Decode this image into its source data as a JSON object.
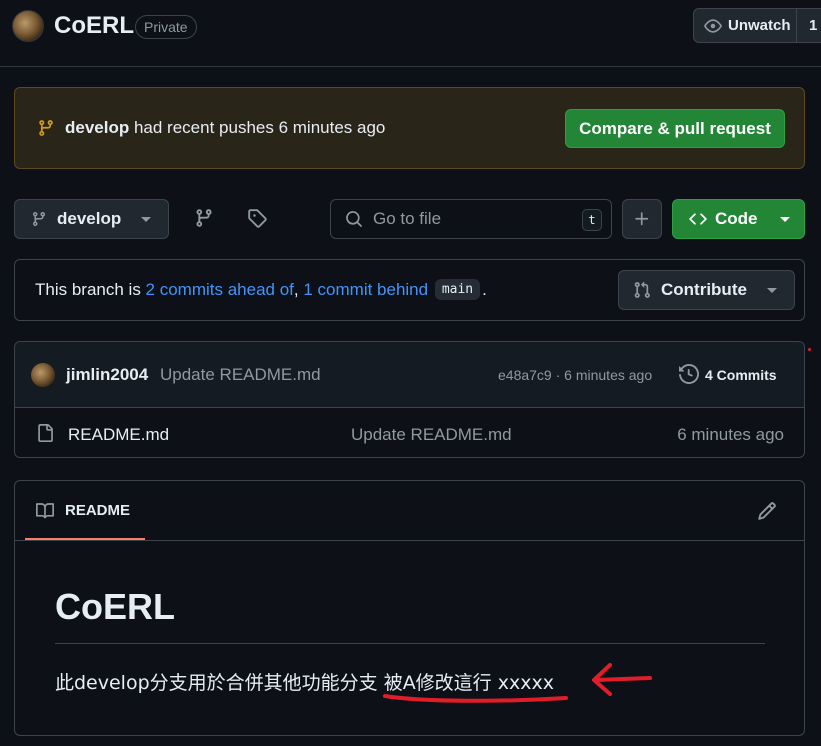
{
  "header": {
    "repo_name": "CoERL",
    "visibility": "Private",
    "watch_label": "Unwatch",
    "watch_count": "1"
  },
  "push_banner": {
    "branch": "develop",
    "message": " had recent pushes 6 minutes ago",
    "button_label": "Compare & pull request"
  },
  "toolbar": {
    "branch": "develop",
    "search_placeholder": "Go to file",
    "search_shortcut": "t",
    "code_label": "Code"
  },
  "branch_status": {
    "prefix": "This branch is ",
    "ahead": "2 commits ahead of",
    "sep": ", ",
    "behind": "1 commit behind",
    "base": "main",
    "suffix": ".",
    "contribute_label": "Contribute"
  },
  "latest_commit": {
    "author": "jimlin2004",
    "message": "Update README.md",
    "meta": "e48a7c9 · 6 minutes ago",
    "commits_label": "4 Commits"
  },
  "files": [
    {
      "name": "README.md",
      "commit": "Update README.md",
      "time": "6 minutes ago"
    }
  ],
  "readme": {
    "tab_label": "README",
    "heading": "CoERL",
    "paragraph": "此develop分支用於合併其他功能分支 被A修改這行 xxxxx"
  },
  "colors": {
    "accent_green": "#238636",
    "link_blue": "#4493f8",
    "banner_bg": "#2a2519",
    "annotation_red": "#e11d2a",
    "tab_underline": "#f78166"
  }
}
